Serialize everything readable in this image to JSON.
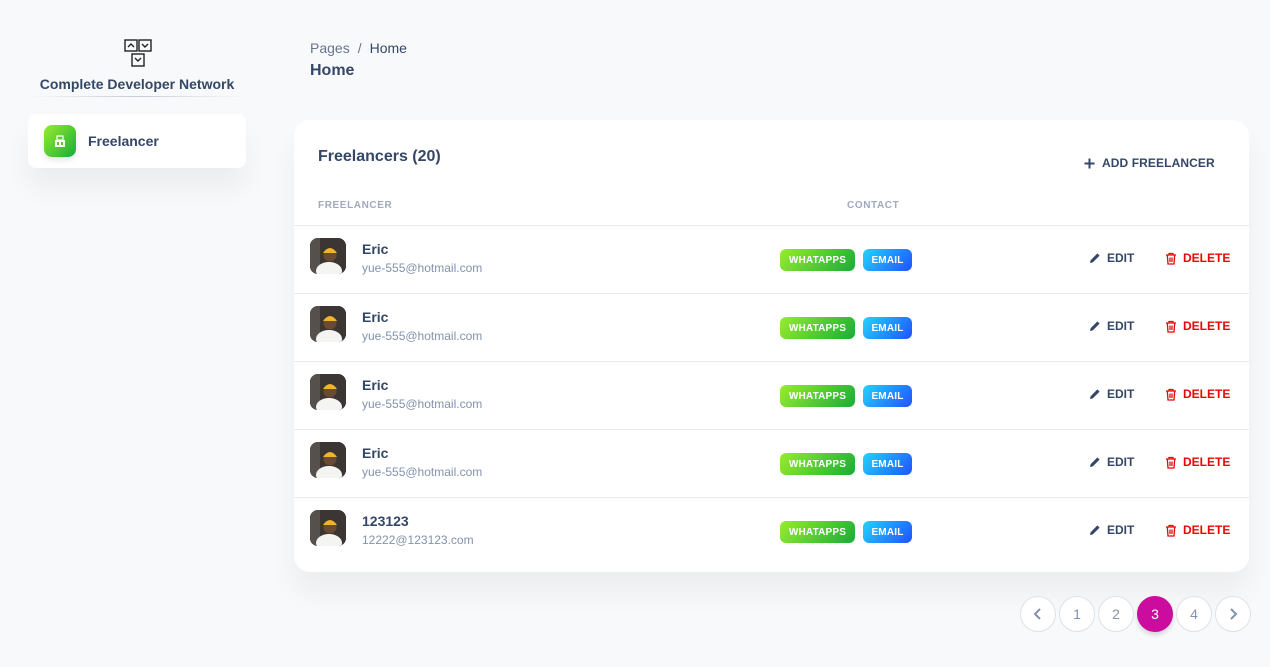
{
  "sidebar": {
    "brand_name": "Complete Developer Network",
    "items": [
      {
        "label": "Freelancer",
        "icon": "shop-icon"
      }
    ]
  },
  "header": {
    "breadcrumb": [
      "Pages",
      "Home"
    ],
    "breadcrumb_separator": "/",
    "title": "Home"
  },
  "card": {
    "title": "Freelancers (20)",
    "add_label": "ADD FREELANCER",
    "columns": [
      "FREELANCER",
      "CONTACT"
    ],
    "rows": [
      {
        "name": "Eric",
        "email": "yue-555@hotmail.com",
        "whatsapp": "WHATAPPS",
        "email_btn": "EMAIL",
        "edit": "EDIT",
        "delete": "DELETE"
      },
      {
        "name": "Eric",
        "email": "yue-555@hotmail.com",
        "whatsapp": "WHATAPPS",
        "email_btn": "EMAIL",
        "edit": "EDIT",
        "delete": "DELETE"
      },
      {
        "name": "Eric",
        "email": "yue-555@hotmail.com",
        "whatsapp": "WHATAPPS",
        "email_btn": "EMAIL",
        "edit": "EDIT",
        "delete": "DELETE"
      },
      {
        "name": "Eric",
        "email": "yue-555@hotmail.com",
        "whatsapp": "WHATAPPS",
        "email_btn": "EMAIL",
        "edit": "EDIT",
        "delete": "DELETE"
      },
      {
        "name": "123123",
        "email": "12222@123123.com",
        "whatsapp": "WHATAPPS",
        "email_btn": "EMAIL",
        "edit": "EDIT",
        "delete": "DELETE"
      }
    ]
  },
  "pagination": {
    "pages": [
      "1",
      "2",
      "3",
      "4"
    ],
    "current": "3"
  },
  "colors": {
    "accent": "#cb0c9f",
    "whatsapp": "#17ad37",
    "email": "#2152ff",
    "delete": "#ea0606",
    "text": "#344767"
  }
}
